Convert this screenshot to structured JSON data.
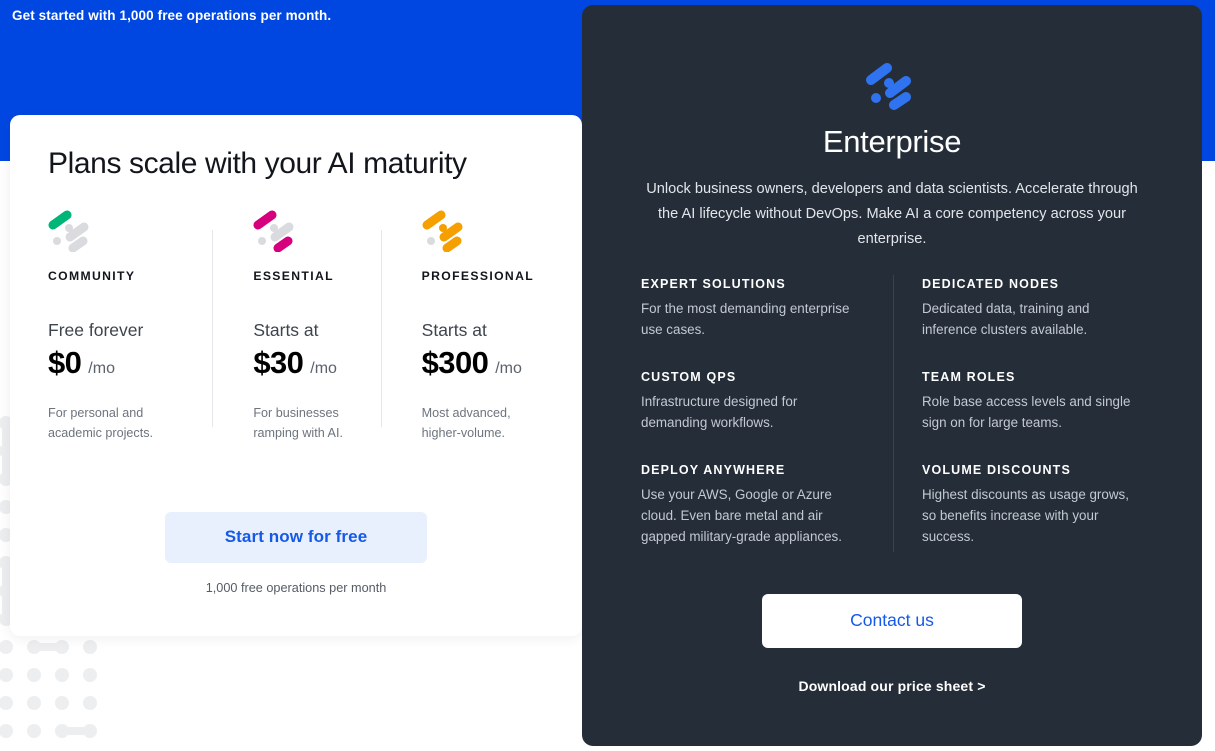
{
  "promo": {
    "text": "Get started with 1,000 free operations per month."
  },
  "colors": {
    "brand_blue": "#0047e1",
    "link_blue": "#1559e8",
    "dark_panel": "#252d38",
    "community_accent": "#00b578",
    "essential_accent": "#d6007f",
    "professional_accent": "#f5a000",
    "enterprise_accent": "#2f73f0",
    "muted_dot": "#d9dbdf"
  },
  "plans_card": {
    "title": "Plans scale with your AI maturity",
    "tiers": [
      {
        "icon": "nodes-icon-community",
        "name": "COMMUNITY",
        "lead": "Free forever",
        "price": "$0",
        "period": "/mo",
        "description": "For personal and academic projects."
      },
      {
        "icon": "nodes-icon-essential",
        "name": "ESSENTIAL",
        "lead": "Starts at",
        "price": "$30",
        "period": "/mo",
        "description": "For businesses ramping with AI."
      },
      {
        "icon": "nodes-icon-professional",
        "name": "PROFESSIONAL",
        "lead": "Starts at",
        "price": "$300",
        "period": "/mo",
        "description": "Most advanced, higher-volume."
      }
    ],
    "cta_label": "Start now for free",
    "cta_note": "1,000 free operations per month"
  },
  "enterprise": {
    "logo_icon": "nodes-icon-enterprise",
    "title": "Enterprise",
    "subtitle": "Unlock business owners, developers and data scientists. Accelerate through the AI lifecycle without DevOps. Make AI a core competency across your enterprise.",
    "features_left": [
      {
        "title": "EXPERT SOLUTIONS",
        "body": "For the most demanding enterprise use cases."
      },
      {
        "title": "CUSTOM QPS",
        "body": "Infrastructure designed for demanding workflows."
      },
      {
        "title": "DEPLOY ANYWHERE",
        "body": "Use your AWS, Google or Azure cloud. Even bare metal and air gapped military-grade appliances."
      }
    ],
    "features_right": [
      {
        "title": "DEDICATED NODES",
        "body": "Dedicated data, training and inference clusters available."
      },
      {
        "title": "TEAM ROLES",
        "body": "Role base access levels and single sign on for large teams."
      },
      {
        "title": "VOLUME DISCOUNTS",
        "body": "Highest discounts as usage grows, so benefits increase with your success."
      }
    ],
    "cta_label": "Contact us",
    "secondary_link": "Download our price sheet >"
  }
}
